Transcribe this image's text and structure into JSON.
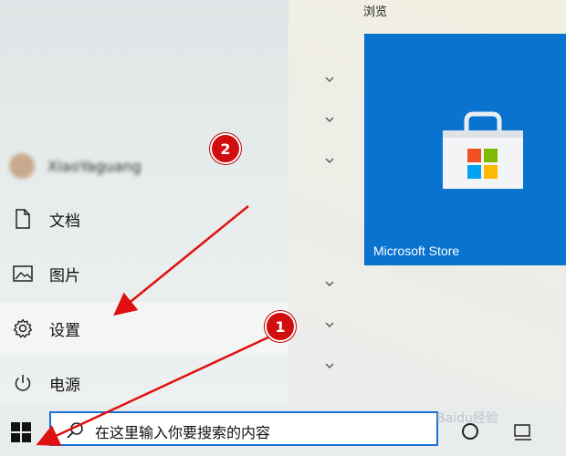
{
  "start_menu": {
    "user_name": "XiaoYaguang",
    "items": [
      {
        "label": "文档",
        "icon": "document-icon"
      },
      {
        "label": "图片",
        "icon": "pictures-icon"
      },
      {
        "label": "设置",
        "icon": "gear-icon"
      },
      {
        "label": "电源",
        "icon": "power-icon"
      }
    ]
  },
  "tiles": {
    "section_label": "浏览",
    "store_tile": {
      "label": "Microsoft Store",
      "color": "#0a73cf"
    }
  },
  "taskbar": {
    "search_text": "在这里输入你要搜索的内容"
  },
  "annotations": {
    "badge_1": "1",
    "badge_2": "2",
    "arrow_color": "#e01010"
  },
  "watermark": "Baidu经验"
}
